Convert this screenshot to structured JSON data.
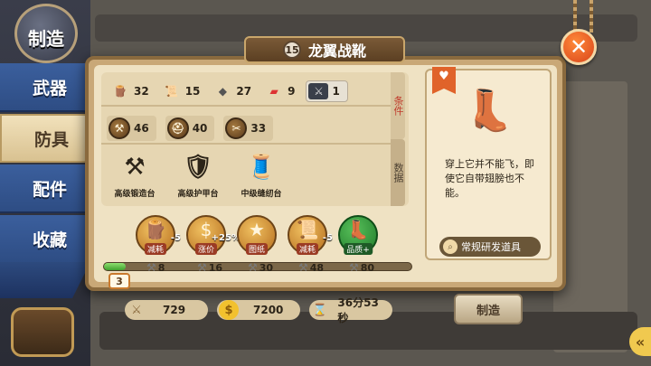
{
  "category_badge": "制造",
  "side_tabs": [
    "武器",
    "防具",
    "配件",
    "收藏"
  ],
  "active_tab_index": 1,
  "item": {
    "level": "15",
    "name": "龙翼战靴",
    "description": "穿上它并不能飞，即使它自带翅膀也不能。",
    "source_label": "常规研发道具"
  },
  "materials": [
    {
      "icon": "wood-icon",
      "glyph": "🪵",
      "value": "32"
    },
    {
      "icon": "scroll-icon",
      "glyph": "📜",
      "value": "15"
    },
    {
      "icon": "ore-icon",
      "glyph": "◆",
      "value": "27"
    },
    {
      "icon": "ruby-icon",
      "glyph": "▰",
      "value": "9"
    },
    {
      "icon": "dragon-fang-icon",
      "glyph": "⚔",
      "value": "1"
    }
  ],
  "skills": [
    {
      "icon": "anvil-skill-icon",
      "glyph": "⚒",
      "value": "46"
    },
    {
      "icon": "helmet-skill-icon",
      "glyph": "⛑",
      "value": "40"
    },
    {
      "icon": "scissors-skill-icon",
      "glyph": "✂",
      "value": "33"
    }
  ],
  "side_labels": {
    "conditions": "条件",
    "data": "数据"
  },
  "stations": [
    {
      "glyph": "⚒",
      "label": "高级锻造台"
    },
    {
      "glyph": "🛡",
      "label": "高级护甲台"
    },
    {
      "glyph": "🧵",
      "label": "中级缝纫台"
    }
  ],
  "effects": [
    {
      "glyph": "🪵",
      "label": "减耗",
      "num": "-5",
      "hammer": "8"
    },
    {
      "glyph": "$",
      "label": "涨价",
      "num": "+25%",
      "hammer": "16"
    },
    {
      "glyph": "★",
      "label": "图纸",
      "num": "",
      "hammer": "30"
    },
    {
      "glyph": "📜",
      "label": "减耗",
      "num": "-5",
      "hammer": "48"
    },
    {
      "glyph": "👢",
      "label": "品质+",
      "num": "",
      "hammer": "80"
    }
  ],
  "progress": {
    "level": "3",
    "fraction": 0.07
  },
  "bottom": {
    "power": "729",
    "gold": "7200",
    "time": "36分53秒"
  },
  "make_button": "制造",
  "colors": {
    "accent": "#e0632a",
    "progress": "#3fa12e",
    "tab_blue": "#2e4d84"
  }
}
